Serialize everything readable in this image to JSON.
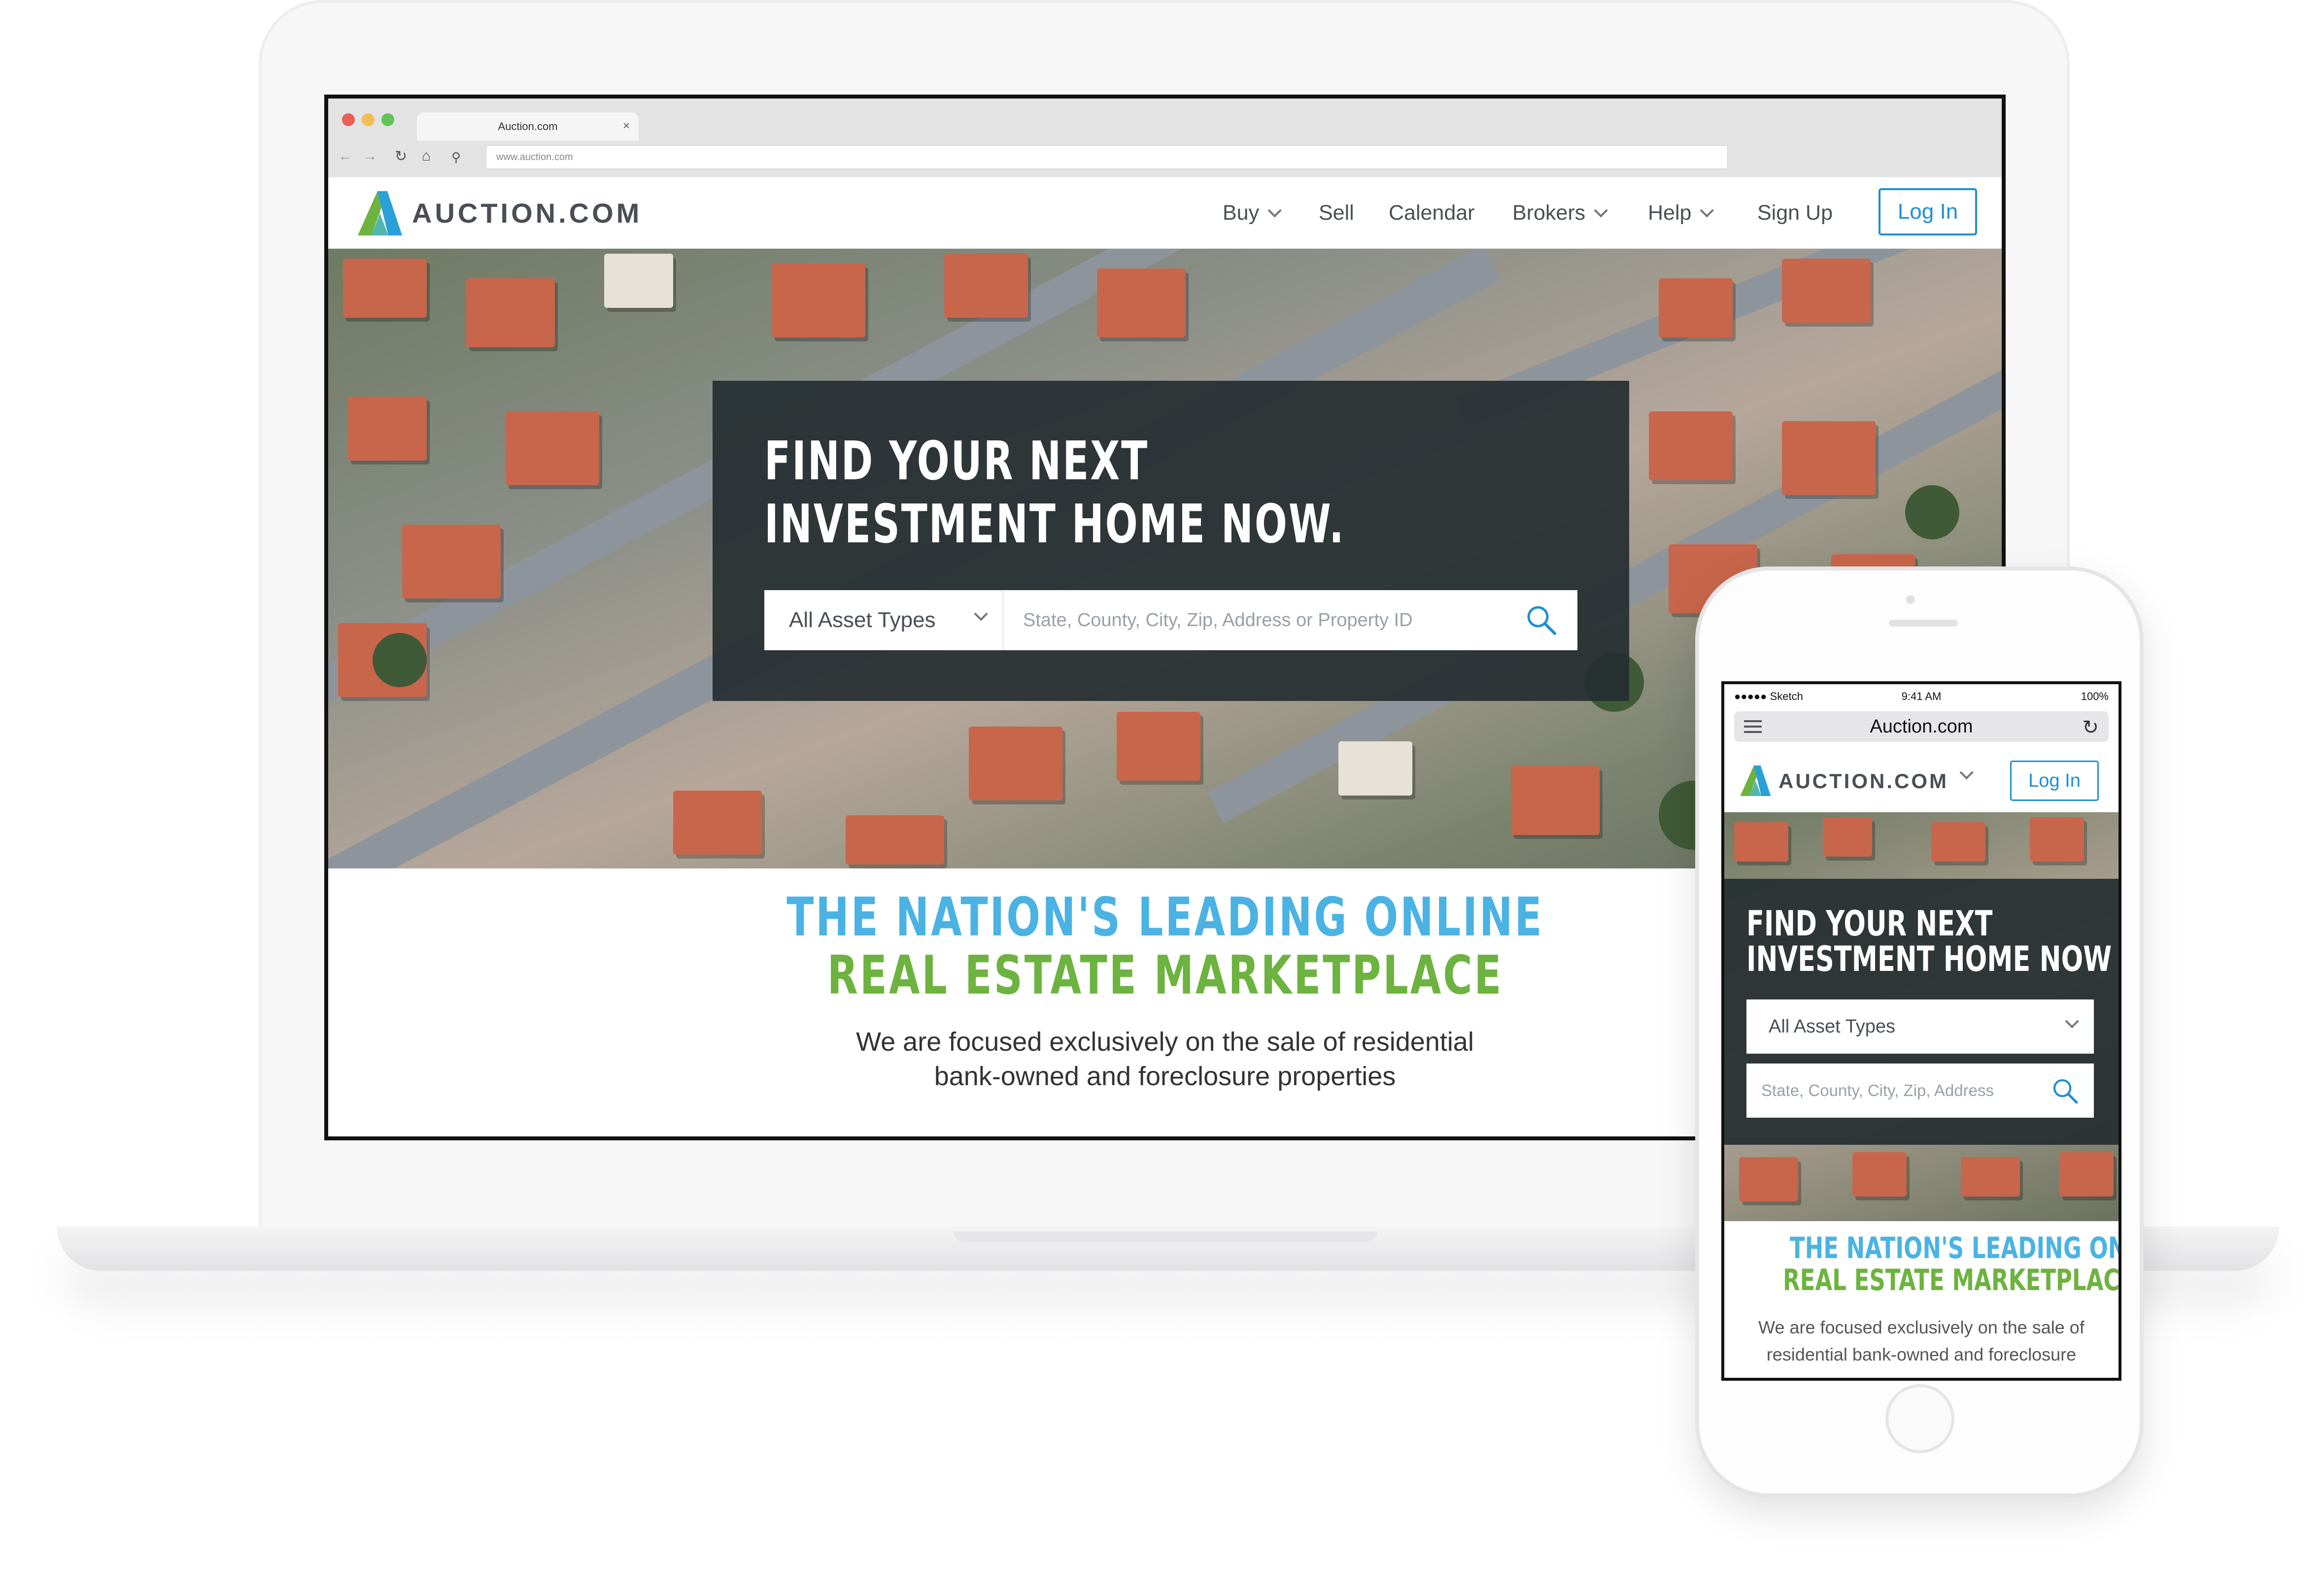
{
  "desktop": {
    "browser": {
      "tab_title": "Auction.com",
      "url": "www.auction.com"
    },
    "header": {
      "logo_text": "AUCTION.COM",
      "nav": [
        "Buy",
        "Sell",
        "Calendar",
        "Brokers",
        "Help",
        "Sign Up"
      ],
      "login_label": "Log In"
    },
    "hero": {
      "title_line1": "FIND YOUR NEXT",
      "title_line2": "INVESTMENT HOME NOW.",
      "asset_select": "All Asset Types",
      "search_placeholder": "State, County, City, Zip, Address or Property ID"
    },
    "headline_line1": "THE NATION'S LEADING ONLINE",
    "headline_line2": "REAL ESTATE MARKETPLACE",
    "tagline_line1": "We are focused exclusively on the sale of residential",
    "tagline_line2": "bank-owned and foreclosure properties"
  },
  "mobile": {
    "status": {
      "carrier": "●●●●● Sketch",
      "time": "9:41 AM",
      "battery": "100%"
    },
    "url_label": "Auction.com",
    "logo_text": "AUCTION.COM",
    "login_label": "Log In",
    "hero": {
      "title_line1": "FIND YOUR NEXT",
      "title_line2": "INVESTMENT HOME NOW",
      "asset_select": "All Asset Types",
      "search_placeholder": "State, County, City, Zip, Address"
    },
    "headline_line1": "THE NATION'S LEADING ONLINE",
    "headline_line2": "REAL ESTATE MARKETPLACE",
    "tagline_line1": "We are focused exclusively on the sale of",
    "tagline_line2": "residential bank-owned and foreclosure"
  },
  "colors": {
    "accent_blue": "#1d8fd6",
    "headline_blue": "#4ab3e3",
    "headline_green": "#6db33f",
    "logo_green": "#6db33f",
    "logo_blue": "#2a9fd8",
    "panel": "#262e32"
  },
  "icons": [
    "close-icon",
    "back-arrow-icon",
    "forward-arrow-icon",
    "reload-icon",
    "home-icon",
    "search-icon",
    "chevron-down-icon",
    "menu-icon",
    "wifi-icon",
    "battery-icon"
  ]
}
